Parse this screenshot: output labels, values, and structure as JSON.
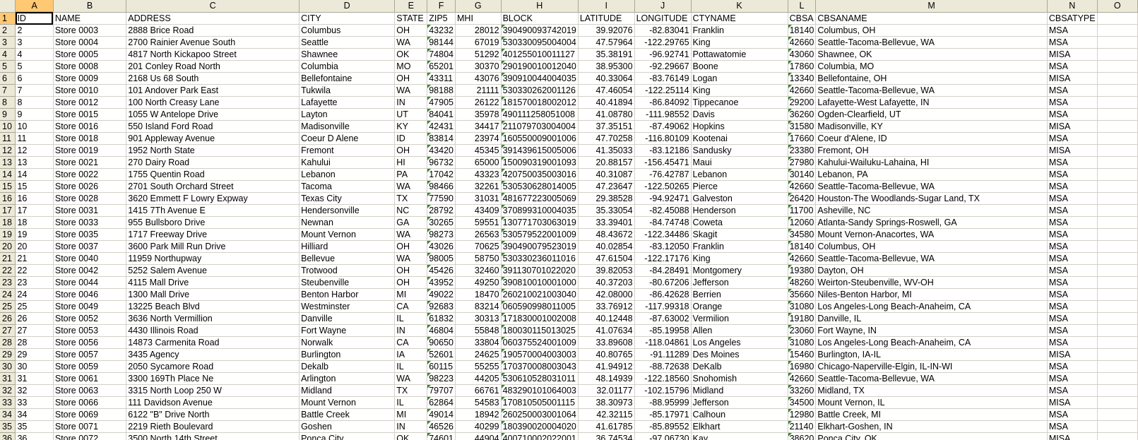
{
  "column_letters": [
    "A",
    "B",
    "C",
    "D",
    "E",
    "F",
    "G",
    "H",
    "I",
    "J",
    "K",
    "L",
    "M",
    "N",
    "O"
  ],
  "selected_column": "A",
  "active_cell": "A1",
  "columns": [
    {
      "key": "ID",
      "type": "text"
    },
    {
      "key": "NAME",
      "type": "text"
    },
    {
      "key": "ADDRESS",
      "type": "text"
    },
    {
      "key": "CITY",
      "type": "text"
    },
    {
      "key": "STATE",
      "type": "text"
    },
    {
      "key": "ZIP5",
      "type": "txtnum"
    },
    {
      "key": "MHI",
      "type": "num"
    },
    {
      "key": "BLOCK",
      "type": "txtnum"
    },
    {
      "key": "LATITUDE",
      "type": "num"
    },
    {
      "key": "LONGITUDE",
      "type": "num"
    },
    {
      "key": "CTYNAME",
      "type": "text"
    },
    {
      "key": "CBSA",
      "type": "txtnum"
    },
    {
      "key": "CBSANAME",
      "type": "text"
    },
    {
      "key": "CBSATYPE",
      "type": "text"
    },
    {
      "key": "",
      "type": "text"
    }
  ],
  "header_row": [
    "ID",
    "NAME",
    "ADDRESS",
    "CITY",
    "STATE",
    "ZIP5",
    "MHI",
    "BLOCK",
    "LATITUDE",
    "LONGITUDE",
    "CTYNAME",
    "CBSA",
    "CBSANAME",
    "CBSATYPE",
    ""
  ],
  "rows": [
    [
      "2",
      "Store 0003",
      "2888 Brice Road",
      "Columbus",
      "OH",
      "43232",
      "28012",
      "390490093742019",
      "39.92076",
      "-82.83041",
      "Franklin",
      "18140",
      "Columbus, OH",
      "MSA",
      ""
    ],
    [
      "3",
      "Store 0004",
      "2700 Rainier Avenue South",
      "Seattle",
      "WA",
      "98144",
      "67019",
      "530330095004004",
      "47.57964",
      "-122.29765",
      "King",
      "42660",
      "Seattle-Tacoma-Bellevue, WA",
      "MSA",
      ""
    ],
    [
      "4",
      "Store 0005",
      "4817 North Kickapoo Street",
      "Shawnee",
      "OK",
      "74804",
      "51292",
      "401255010011127",
      "35.38191",
      "-96.92741",
      "Pottawatomie",
      "43060",
      "Shawnee, OK",
      "MISA",
      ""
    ],
    [
      "5",
      "Store 0008",
      "201 Conley Road North",
      "Columbia",
      "MO",
      "65201",
      "30370",
      "290190010012040",
      "38.95300",
      "-92.29667",
      "Boone",
      "17860",
      "Columbia, MO",
      "MSA",
      ""
    ],
    [
      "6",
      "Store 0009",
      "2168 Us 68 South",
      "Bellefontaine",
      "OH",
      "43311",
      "43076",
      "390910044004035",
      "40.33064",
      "-83.76149",
      "Logan",
      "13340",
      "Bellefontaine, OH",
      "MISA",
      ""
    ],
    [
      "7",
      "Store 0010",
      "101 Andover Park East",
      "Tukwila",
      "WA",
      "98188",
      "21111",
      "530330262001126",
      "47.46054",
      "-122.25114",
      "King",
      "42660",
      "Seattle-Tacoma-Bellevue, WA",
      "MSA",
      ""
    ],
    [
      "8",
      "Store 0012",
      "100 North Creasy Lane",
      "Lafayette",
      "IN",
      "47905",
      "26122",
      "181570018002012",
      "40.41894",
      "-86.84092",
      "Tippecanoe",
      "29200",
      "Lafayette-West Lafayette, IN",
      "MSA",
      ""
    ],
    [
      "9",
      "Store 0015",
      "1055 W Antelope Drive",
      "Layton",
      "UT",
      "84041",
      "35978",
      "490111258051008",
      "41.08780",
      "-111.98552",
      "Davis",
      "36260",
      "Ogden-Clearfield, UT",
      "MSA",
      ""
    ],
    [
      "10",
      "Store 0016",
      "550 Island Ford Road",
      "Madisonville",
      "KY",
      "42431",
      "34417",
      "211079703004004",
      "37.35151",
      "-87.49062",
      "Hopkins",
      "31580",
      "Madisonville, KY",
      "MISA",
      ""
    ],
    [
      "11",
      "Store 0018",
      "901 Appleway Avenue",
      "Coeur D Alene",
      "ID",
      "83814",
      "23974",
      "160550009001006",
      "47.70258",
      "-116.80109",
      "Kootenai",
      "17660",
      "Coeur d'Alene, ID",
      "MSA",
      ""
    ],
    [
      "12",
      "Store 0019",
      "1952 North State",
      "Fremont",
      "OH",
      "43420",
      "45345",
      "391439615005006",
      "41.35033",
      "-83.12186",
      "Sandusky",
      "23380",
      "Fremont, OH",
      "MISA",
      ""
    ],
    [
      "13",
      "Store 0021",
      "270 Dairy Road",
      "Kahului",
      "HI",
      "96732",
      "65000",
      "150090319001093",
      "20.88157",
      "-156.45471",
      "Maui",
      "27980",
      "Kahului-Wailuku-Lahaina, HI",
      "MSA",
      ""
    ],
    [
      "14",
      "Store 0022",
      "1755 Quentin Road",
      "Lebanon",
      "PA",
      "17042",
      "43323",
      "420750035003016",
      "40.31087",
      "-76.42787",
      "Lebanon",
      "30140",
      "Lebanon, PA",
      "MSA",
      ""
    ],
    [
      "15",
      "Store 0026",
      "2701 South Orchard Street",
      "Tacoma",
      "WA",
      "98466",
      "32261",
      "530530628014005",
      "47.23647",
      "-122.50265",
      "Pierce",
      "42660",
      "Seattle-Tacoma-Bellevue, WA",
      "MSA",
      ""
    ],
    [
      "16",
      "Store 0028",
      "3620 Emmett F Lowry Expway",
      "Texas City",
      "TX",
      "77590",
      "31031",
      "481677223005069",
      "29.38528",
      "-94.92471",
      "Galveston",
      "26420",
      "Houston-The Woodlands-Sugar Land, TX",
      "MSA",
      ""
    ],
    [
      "17",
      "Store 0031",
      "1415 7Th Avenue E",
      "Hendersonville",
      "NC",
      "28792",
      "43409",
      "370899310004035",
      "35.33054",
      "-82.45088",
      "Henderson",
      "11700",
      "Asheville, NC",
      "MSA",
      ""
    ],
    [
      "18",
      "Store 0033",
      "955 Bullsboro Drive",
      "Newnan",
      "GA",
      "30265",
      "59551",
      "130771703063019",
      "33.39401",
      "-84.74748",
      "Coweta",
      "12060",
      "Atlanta-Sandy Springs-Roswell, GA",
      "MSA",
      ""
    ],
    [
      "19",
      "Store 0035",
      "1717 Freeway Drive",
      "Mount Vernon",
      "WA",
      "98273",
      "26563",
      "530579522001009",
      "48.43672",
      "-122.34486",
      "Skagit",
      "34580",
      "Mount Vernon-Anacortes, WA",
      "MSA",
      ""
    ],
    [
      "20",
      "Store 0037",
      "3600 Park Mill Run Drive",
      "Hilliard",
      "OH",
      "43026",
      "70625",
      "390490079523019",
      "40.02854",
      "-83.12050",
      "Franklin",
      "18140",
      "Columbus, OH",
      "MSA",
      ""
    ],
    [
      "21",
      "Store 0040",
      "11959 Northupway",
      "Bellevue",
      "WA",
      "98005",
      "58750",
      "530330236011016",
      "47.61504",
      "-122.17176",
      "King",
      "42660",
      "Seattle-Tacoma-Bellevue, WA",
      "MSA",
      ""
    ],
    [
      "22",
      "Store 0042",
      "5252 Salem Avenue",
      "Trotwood",
      "OH",
      "45426",
      "32460",
      "391130701022020",
      "39.82053",
      "-84.28491",
      "Montgomery",
      "19380",
      "Dayton, OH",
      "MSA",
      ""
    ],
    [
      "23",
      "Store 0044",
      "4115 Mall Drive",
      "Steubenville",
      "OH",
      "43952",
      "49250",
      "390810010001000",
      "40.37203",
      "-80.67206",
      "Jefferson",
      "48260",
      "Weirton-Steubenville, WV-OH",
      "MSA",
      ""
    ],
    [
      "24",
      "Store 0046",
      "1300 Mall Drive",
      "Benton Harbor",
      "MI",
      "49022",
      "18470",
      "260210021003040",
      "42.08000",
      "-86.42628",
      "Berrien",
      "35660",
      "Niles-Benton Harbor, MI",
      "MSA",
      ""
    ],
    [
      "25",
      "Store 0049",
      "13225 Beach Blvd",
      "Westminster",
      "CA",
      "92683",
      "83214",
      "060590998011005",
      "33.76912",
      "-117.99318",
      "Orange",
      "31080",
      "Los Angeles-Long Beach-Anaheim, CA",
      "MSA",
      ""
    ],
    [
      "26",
      "Store 0052",
      "3636 North Vermillion",
      "Danville",
      "IL",
      "61832",
      "30313",
      "171830001002008",
      "40.12448",
      "-87.63002",
      "Vermilion",
      "19180",
      "Danville, IL",
      "MSA",
      ""
    ],
    [
      "27",
      "Store 0053",
      "4430 Illinois Road",
      "Fort Wayne",
      "IN",
      "46804",
      "55848",
      "180030115013025",
      "41.07634",
      "-85.19958",
      "Allen",
      "23060",
      "Fort Wayne, IN",
      "MSA",
      ""
    ],
    [
      "28",
      "Store 0056",
      "14873 Carmenita Road",
      "Norwalk",
      "CA",
      "90650",
      "33804",
      "060375524001009",
      "33.89608",
      "-118.04861",
      "Los Angeles",
      "31080",
      "Los Angeles-Long Beach-Anaheim, CA",
      "MSA",
      ""
    ],
    [
      "29",
      "Store 0057",
      "3435 Agency",
      "Burlington",
      "IA",
      "52601",
      "24625",
      "190570004003003",
      "40.80765",
      "-91.11289",
      "Des Moines",
      "15460",
      "Burlington, IA-IL",
      "MISA",
      ""
    ],
    [
      "30",
      "Store 0059",
      "2050 Sycamore Road",
      "Dekalb",
      "IL",
      "60115",
      "55255",
      "170370008003043",
      "41.94912",
      "-88.72638",
      "DeKalb",
      "16980",
      "Chicago-Naperville-Elgin, IL-IN-WI",
      "MSA",
      ""
    ],
    [
      "31",
      "Store 0061",
      "3300 169Th Place Ne",
      "Arlington",
      "WA",
      "98223",
      "44205",
      "530610528031011",
      "48.14939",
      "-122.18560",
      "Snohomish",
      "42660",
      "Seattle-Tacoma-Bellevue, WA",
      "MSA",
      ""
    ],
    [
      "32",
      "Store 0063",
      "3315 North Loop 250 W",
      "Midland",
      "TX",
      "79707",
      "66761",
      "483290101064003",
      "32.01177",
      "-102.15796",
      "Midland",
      "33260",
      "Midland, TX",
      "MSA",
      ""
    ],
    [
      "33",
      "Store 0066",
      "111 Davidson Avenue",
      "Mount Vernon",
      "IL",
      "62864",
      "54583",
      "170810505001115",
      "38.30973",
      "-88.95999",
      "Jefferson",
      "34500",
      "Mount Vernon, IL",
      "MISA",
      ""
    ],
    [
      "34",
      "Store 0069",
      "6122 \"B\" Drive North",
      "Battle Creek",
      "MI",
      "49014",
      "18942",
      "260250003001064",
      "42.32115",
      "-85.17971",
      "Calhoun",
      "12980",
      "Battle Creek, MI",
      "MSA",
      ""
    ],
    [
      "35",
      "Store 0071",
      "2219 Rieth Boulevard",
      "Goshen",
      "IN",
      "46526",
      "40299",
      "180390020004020",
      "41.61785",
      "-85.89552",
      "Elkhart",
      "21140",
      "Elkhart-Goshen, IN",
      "MSA",
      ""
    ],
    [
      "36",
      "Store 0072",
      "3500 North 14th Street",
      "Ponca City",
      "OK",
      "74601",
      "44904",
      "400710002022001",
      "36.74534",
      "-97.06730",
      "Kay",
      "38620",
      "Ponca City, OK",
      "MISA",
      ""
    ]
  ]
}
